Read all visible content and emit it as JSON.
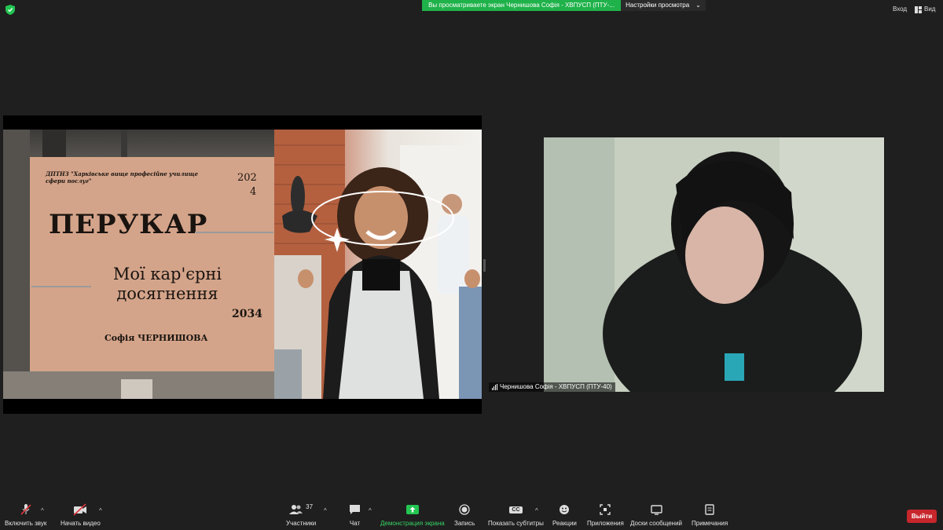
{
  "top_bar": {
    "share_banner": "Вы просматриваете экран Чернишова Софія - ХВПУСП (ПТУ-...",
    "view_settings_label": "Настройки просмотра",
    "enter_label": "Вход",
    "view_label": "Вид"
  },
  "slide": {
    "school_name": "ДПТНЗ \"Харківське вище професійне училище сфери послуг\"",
    "year_start_line1": "202",
    "year_start_line2": "4",
    "title": "ПЕРУКАР",
    "subtitle_line1": "Мої кар'єрні",
    "subtitle_line2": "досягнення",
    "year_end": "2034",
    "author": "Софія ЧЕРНИШОВА"
  },
  "participant": {
    "name": "Чернишова Софія - ХВПУСП (ПТУ-40)"
  },
  "toolbar": {
    "mute_label": "Включить звук",
    "video_label": "Начать видео",
    "participants_label": "Участники",
    "participants_count": "37",
    "chat_label": "Чат",
    "share_label": "Демонстрация экрана",
    "record_label": "Запись",
    "captions_label": "Показать субтитры",
    "captions_icon_text": "CC",
    "reactions_label": "Реакции",
    "apps_label": "Приложения",
    "whiteboards_label": "Доски сообщений",
    "notes_label": "Примечания",
    "leave_label": "Выйти"
  },
  "colors": {
    "background": "#1f1f1f",
    "share_green": "#1fb24a",
    "leave_red": "#c7262c",
    "slide_card": "#d4a48a"
  }
}
